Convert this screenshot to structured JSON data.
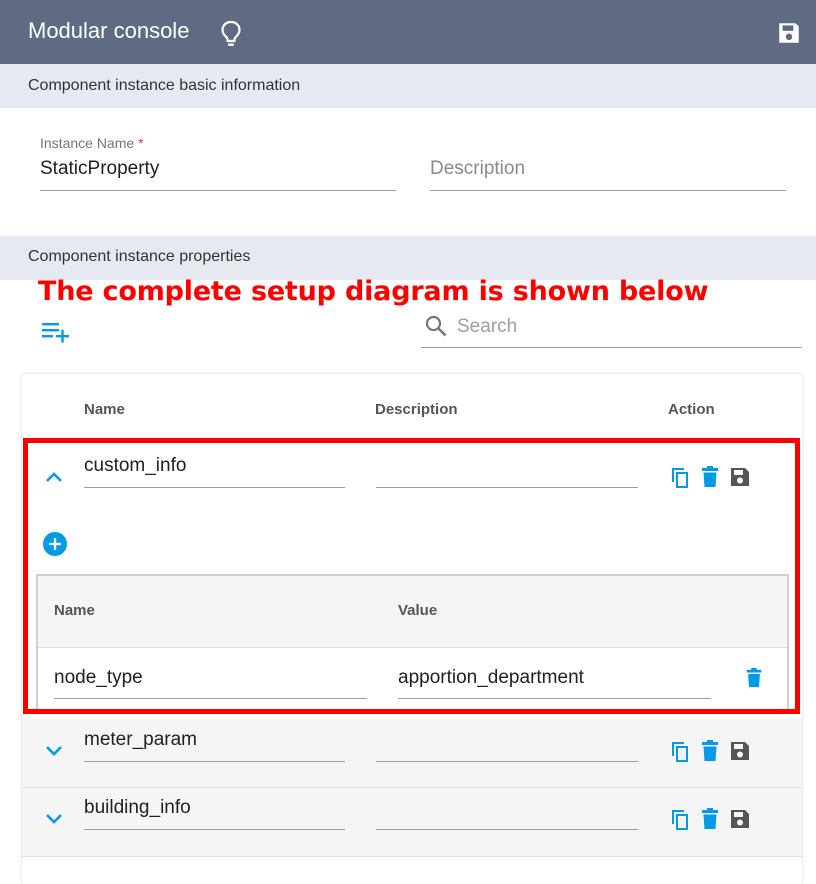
{
  "header": {
    "title": "Modular console",
    "bulb_icon": "lightbulb-outline-icon",
    "save_icon": "save-icon",
    "background": "#5f6b82"
  },
  "basic_info": {
    "section_title": "Component instance basic information",
    "instance_name_label": "Instance Name",
    "required_mark": "*",
    "instance_name_value": "StaticProperty",
    "description_placeholder": "Description"
  },
  "properties": {
    "section_title": "Component instance properties",
    "annotation": "The complete setup diagram is shown below",
    "search_placeholder": "Search",
    "columns": {
      "name": "Name",
      "description": "Description",
      "action": "Action"
    },
    "rows": [
      {
        "name": "custom_info",
        "description": "",
        "expanded": true
      },
      {
        "name": "meter_param",
        "description": "",
        "expanded": false
      },
      {
        "name": "building_info",
        "description": "",
        "expanded": false
      }
    ],
    "subtable": {
      "columns": {
        "name": "Name",
        "value": "Value"
      },
      "rows": [
        {
          "name": "node_type",
          "value": "apportion_department"
        }
      ]
    },
    "accent_color": "#039be5",
    "annotation_color": "#ff0000"
  }
}
